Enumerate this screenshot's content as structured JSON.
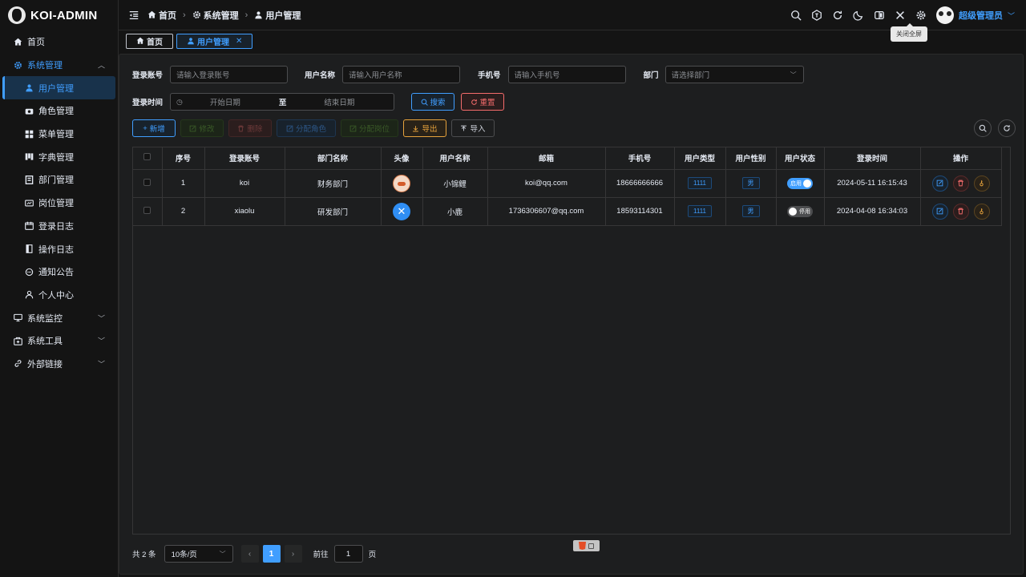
{
  "app": {
    "logo_text": "KOI-ADMIN"
  },
  "sidebar": {
    "items": [
      {
        "label": "首页",
        "icon": "home-icon"
      },
      {
        "label": "系统管理",
        "icon": "gear-icon"
      },
      {
        "label": "用户管理",
        "icon": "user-icon"
      },
      {
        "label": "角色管理",
        "icon": "camera-icon"
      },
      {
        "label": "菜单管理",
        "icon": "grid-icon"
      },
      {
        "label": "字典管理",
        "icon": "dict-icon"
      },
      {
        "label": "部门管理",
        "icon": "dept-icon"
      },
      {
        "label": "岗位管理",
        "icon": "post-icon"
      },
      {
        "label": "登录日志",
        "icon": "calendar-icon"
      },
      {
        "label": "操作日志",
        "icon": "log-icon"
      },
      {
        "label": "通知公告",
        "icon": "chat-icon"
      },
      {
        "label": "个人中心",
        "icon": "person-icon"
      },
      {
        "label": "系统监控",
        "icon": "monitor-icon"
      },
      {
        "label": "系统工具",
        "icon": "toolbox-icon"
      },
      {
        "label": "外部链接",
        "icon": "link-icon"
      }
    ]
  },
  "header": {
    "breadcrumb": [
      "首页",
      "系统管理",
      "用户管理"
    ],
    "user_name": "超级管理员",
    "tooltip": "关闭全屏"
  },
  "tabs": [
    {
      "label": "首页"
    },
    {
      "label": "用户管理"
    }
  ],
  "filters": {
    "login_name_label": "登录账号",
    "login_name_placeholder": "请输入登录账号",
    "user_name_label": "用户名称",
    "user_name_placeholder": "请输入用户名称",
    "phone_label": "手机号",
    "phone_placeholder": "请输入手机号",
    "dept_label": "部门",
    "dept_placeholder": "请选择部门",
    "login_time_label": "登录时间",
    "start_date": "开始日期",
    "range_sep": "至",
    "end_date": "结束日期",
    "search_btn": "搜索",
    "reset_btn": "重置"
  },
  "toolbar": {
    "add": "新增",
    "edit": "修改",
    "delete": "删除",
    "assign_role": "分配角色",
    "assign_post": "分配岗位",
    "export": "导出",
    "import": "导入"
  },
  "table": {
    "columns": [
      "序号",
      "登录账号",
      "部门名称",
      "头像",
      "用户名称",
      "邮箱",
      "手机号",
      "用户类型",
      "用户性别",
      "用户状态",
      "登录时间",
      "操作"
    ],
    "rows": [
      {
        "index": "1",
        "login": "koi",
        "dept": "财务部门",
        "name": "小锦鲤",
        "email": "koi@qq.com",
        "phone": "18666666666",
        "type": "1111",
        "sex": "男",
        "status": "启用",
        "time": "2024-05-11 16:15:43"
      },
      {
        "index": "2",
        "login": "xiaolu",
        "dept": "研发部门",
        "name": "小鹿",
        "email": "1736306607@qq.com",
        "phone": "18593114301",
        "type": "1111",
        "sex": "男",
        "status": "停用",
        "time": "2024-04-08 16:34:03"
      }
    ]
  },
  "pager": {
    "total": "共 2 条",
    "page_size": "10条/页",
    "current": "1",
    "goto_label": "前往",
    "goto_value": "1",
    "page_suffix": "页"
  },
  "colors": {
    "accent": "#409eff",
    "danger": "#f56c6c",
    "warning": "#e6a23c",
    "success": "#67c23a"
  }
}
